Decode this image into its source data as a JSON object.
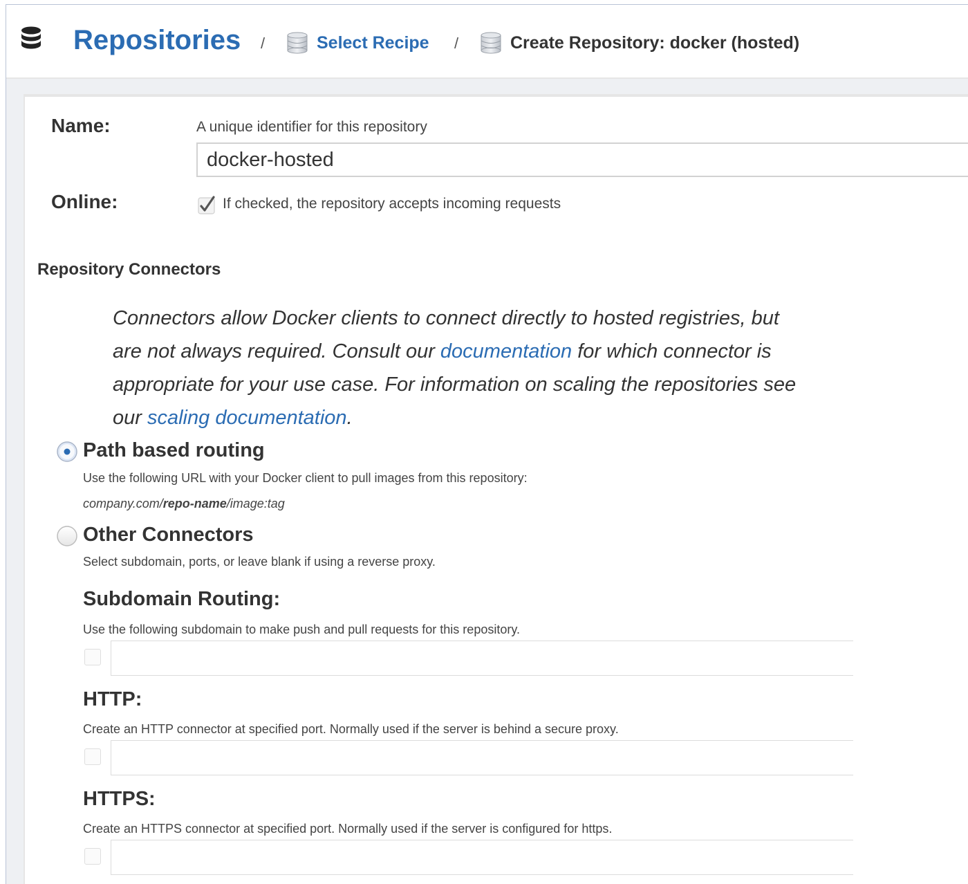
{
  "breadcrumb": {
    "root": "Repositories",
    "separator": "/",
    "recipe": "Select Recipe",
    "current": "Create Repository: docker (hosted)",
    "root_icon": "database-icon",
    "crumb_icon": "database-icon"
  },
  "form": {
    "name_label": "Name:",
    "name_help": "A unique identifier for this repository",
    "name_value": "docker-hosted",
    "online_label": "Online:",
    "online_help": "If checked, the repository accepts incoming requests",
    "online_checked": true
  },
  "connectors": {
    "title": "Repository Connectors",
    "desc_part1": "Connectors allow Docker clients to connect directly to hosted registries, but are not always required. Consult our ",
    "desc_link1": "documentation",
    "desc_part2": " for which connector is appropriate for your use case. For information on scaling the repositories see our ",
    "desc_link2": "scaling documentation",
    "desc_part3": ".",
    "path_routing": {
      "label": "Path based routing",
      "help": "Use the following URL with your Docker client to pull images from this repository:",
      "url_prefix": "company.com/",
      "url_bold": "repo-name",
      "url_suffix": "/image:tag",
      "selected": true
    },
    "other": {
      "label": "Other Connectors",
      "help": "Select subdomain, ports, or leave blank if using a reverse proxy.",
      "selected": false
    },
    "subdomain": {
      "title": "Subdomain Routing:",
      "help": "Use the following subdomain to make push and pull requests for this repository.",
      "value": ""
    },
    "http": {
      "title": "HTTP:",
      "help": "Create an HTTP connector at specified port. Normally used if the server is behind a secure proxy.",
      "value": ""
    },
    "https": {
      "title": "HTTPS:",
      "help": "Create an HTTPS connector at specified port. Normally used if the server is configured for https.",
      "value": ""
    }
  },
  "colors": {
    "link": "#2b6cb3",
    "radio_selected": "#2b6cb3",
    "border": "#d2d2d2"
  }
}
